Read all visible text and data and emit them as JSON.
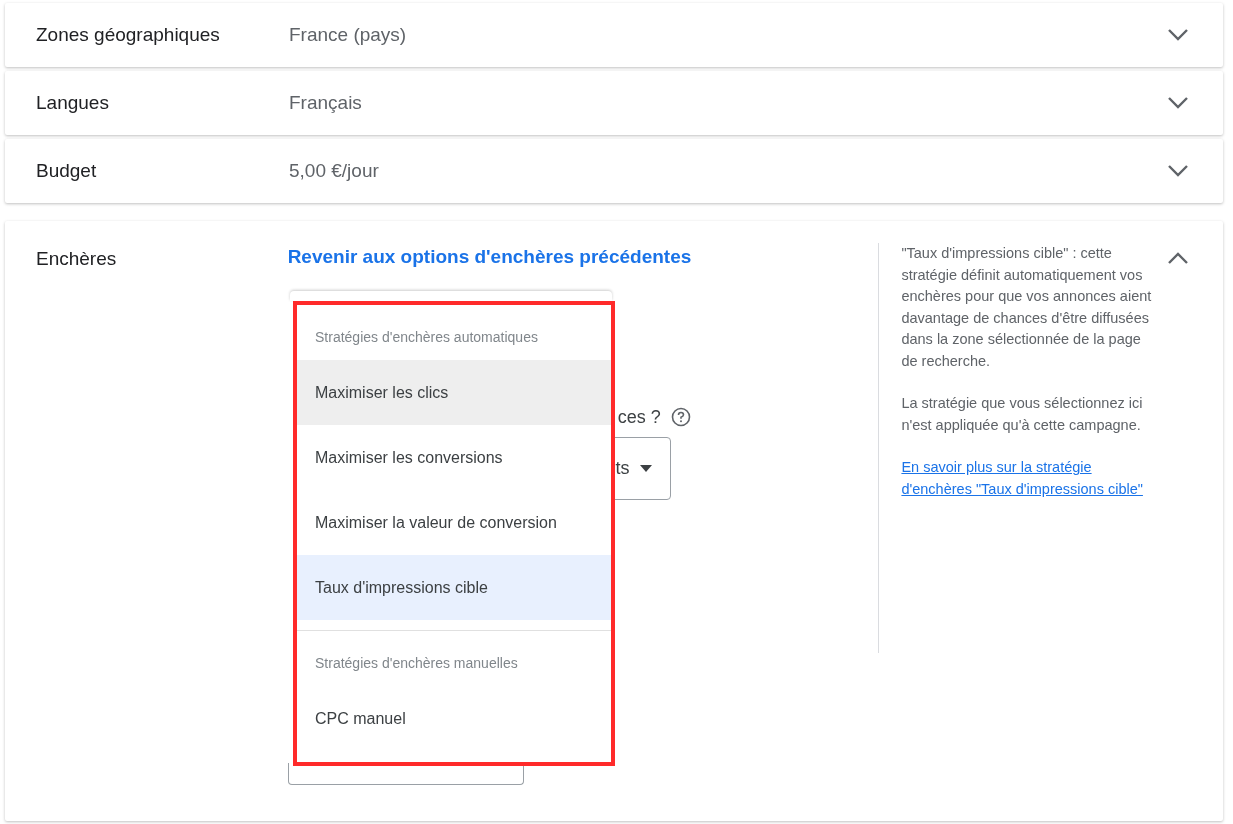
{
  "rows": [
    {
      "label": "Zones géographiques",
      "value": "France (pays)",
      "expanded": false
    },
    {
      "label": "Langues",
      "value": "Français",
      "expanded": false
    },
    {
      "label": "Budget",
      "value": "5,00 €/jour",
      "expanded": false
    }
  ],
  "bidding": {
    "label": "Enchères",
    "back_link": "Revenir aux options d'enchères précédentes",
    "expanded": true,
    "question_fragment": "ces ?",
    "select_fragment": "ts",
    "menu": [
      {
        "kind": "header",
        "label": "Stratégies d'enchères automatiques"
      },
      {
        "kind": "option",
        "label": "Maximiser les clics",
        "selected": false,
        "hovered": true
      },
      {
        "kind": "option",
        "label": "Maximiser les conversions",
        "selected": false,
        "hovered": false
      },
      {
        "kind": "option",
        "label": "Maximiser la valeur de conversion",
        "selected": false,
        "hovered": false
      },
      {
        "kind": "option",
        "label": "Taux d'impressions cible",
        "selected": true,
        "hovered": false
      },
      {
        "kind": "divider"
      },
      {
        "kind": "header",
        "label": "Stratégies d'enchères manuelles"
      },
      {
        "kind": "option",
        "label": "CPC manuel",
        "selected": false,
        "hovered": false
      }
    ],
    "help": {
      "paragraphs": [
        "\"Taux d'impressions cible\" : cette stratégie définit automatiquement vos enchères pour que vos annonces aient davantage de chances d'être diffusées dans la zone sélectionnée de la page de recherche.",
        "La stratégie que vous sélectionnez ici n'est appliquée qu'à cette campagne."
      ],
      "link": "En savoir plus sur la stratégie d'enchères \"Taux d'impressions cible\""
    }
  }
}
